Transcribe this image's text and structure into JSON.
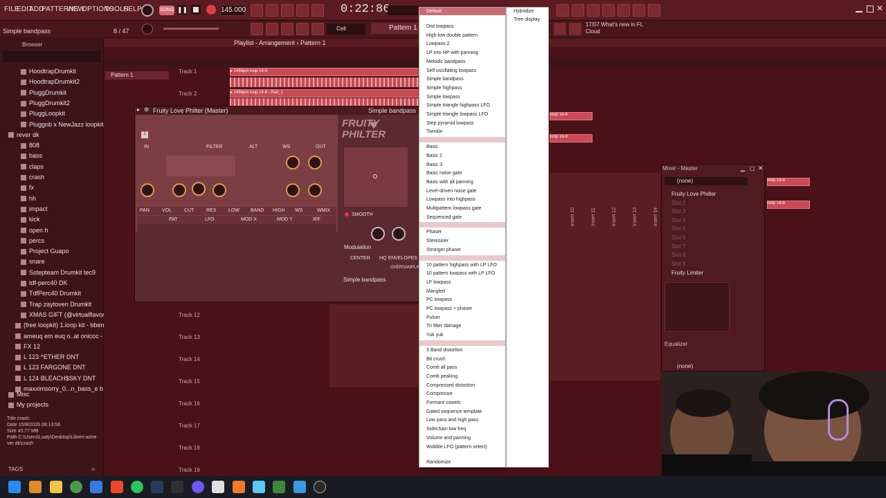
{
  "menu": {
    "items": [
      "FILE",
      "EDIT",
      "ADD",
      "PATTERNS",
      "VIEW",
      "OPTIONS",
      "TOOLS",
      "HELP"
    ],
    "song_label": "SONG",
    "bpm": "145.000",
    "time": "0:22:86"
  },
  "hint": {
    "text": "Simple bandpass",
    "count": "8 / 47"
  },
  "toolbar": {
    "snap_label": "Cell",
    "pattern": "Pattern 1",
    "news_date": "17/07",
    "news_title": "What's new in FL",
    "news_sub": "Cloud"
  },
  "browser": {
    "title": "Browser",
    "items": [
      {
        "label": "HoodtrapDrumkit",
        "type": "folder"
      },
      {
        "label": "HoodtrapDrumkit2",
        "type": "folder"
      },
      {
        "label": "PluggDrumkit",
        "type": "folder"
      },
      {
        "label": "PluggDrumkit2",
        "type": "folder"
      },
      {
        "label": "PluggLoopkit",
        "type": "folder"
      },
      {
        "label": "Pluggnb x NewJazz loopkit",
        "type": "folder"
      },
      {
        "label": "rever dk",
        "type": "folder"
      },
      {
        "label": "808",
        "type": "folder"
      },
      {
        "label": "bass",
        "type": "folder"
      },
      {
        "label": "claps",
        "type": "folder"
      },
      {
        "label": "crash",
        "type": "folder"
      },
      {
        "label": "fx",
        "type": "folder"
      },
      {
        "label": "hh",
        "type": "folder"
      },
      {
        "label": "impact",
        "type": "folder"
      },
      {
        "label": "kick",
        "type": "folder"
      },
      {
        "label": "open h",
        "type": "folder"
      },
      {
        "label": "percs",
        "type": "folder"
      },
      {
        "label": "Project Guapo",
        "type": "folder"
      },
      {
        "label": "snare",
        "type": "folder"
      },
      {
        "label": "Sstepteam Drumkit tec9",
        "type": "folder"
      },
      {
        "label": "tdf-perc40 DK",
        "type": "folder"
      },
      {
        "label": "TdfPerc40 Drumkit",
        "type": "folder"
      },
      {
        "label": "Trap zaytoven Drumkit",
        "type": "folder"
      },
      {
        "label": "XMAS GIFT (@virtualflavor)",
        "type": "folder"
      },
      {
        "label": "(free loopkit) 1.loop kit - bbeno",
        "type": "file"
      },
      {
        "label": "ameuq em euq o..at onicoc - tag",
        "type": "file"
      },
      {
        "label": "FX 12",
        "type": "file"
      },
      {
        "label": "L 123 ^ETHER DNT",
        "type": "file"
      },
      {
        "label": "L 123 FARGONE DNT",
        "type": "file"
      },
      {
        "label": "L 124 BLEACH$SKY DNT",
        "type": "file"
      },
      {
        "label": "maxximsorry_0...n_bass_e b c a",
        "type": "file"
      },
      {
        "label": "Misc",
        "type": "folder"
      },
      {
        "label": "My projects",
        "type": "folder"
      }
    ],
    "info_title_key": "Title",
    "info_title": "crash",
    "info_date_key": "Date",
    "info_date": "15/8/2026 06:13:56",
    "info_size_key": "Size",
    "info_size": "43.77 MB",
    "info_path_key": "Path",
    "info_path": "C:\\Users\\Luaty\\Desktop\\Libreri-as\\rever dk\\crash",
    "tags": "TAGS"
  },
  "playlist": {
    "title": "Playlist - Arrangement › Pattern 1",
    "pattern_item": "Pattern 1",
    "tracks": [
      "Track 1",
      "Track 2",
      "Track 12",
      "Track 13",
      "Track 14",
      "Track 15",
      "Track 16",
      "Track 17",
      "Track 18",
      "Track 19"
    ],
    "clip_text_1": "▸ 145bpm loop 16-8",
    "clip_text_2": "▸ 145bpm loop 16-8 - Part_1",
    "clip_text_right": "loop 16-8"
  },
  "plugin": {
    "title": "Fruity Love Philter (Master)",
    "preset": "Simple bandpass",
    "logo_line1": "FRUITY",
    "logo_line2": "PHILTER",
    "in_label": "IN",
    "filter_label": "FILTER",
    "alt_label": "ALT",
    "ws_label": "WS",
    "out_label": "OUT",
    "tabs": [
      "PAN",
      "VOL",
      "CUT",
      "RES",
      "LOW",
      "BAND",
      "HIGH",
      "WS",
      "WMIX"
    ],
    "sub_tabs": [
      "PAT",
      "LFO",
      "MOD X",
      "MOD Y",
      "IEF"
    ],
    "smooth_label": "SMOOTH",
    "modulation_label": "Modulation",
    "center_label": "CENTER",
    "hq_label": "HQ ENVELOPES",
    "oversampling_label": "OVERSAMPLING",
    "footer_preset": "Simple bandpass",
    "page_number": "1"
  },
  "dropdown": {
    "header": "Default",
    "groups": [
      [
        "Dist lowpass",
        "High-low double pattern",
        "Lowpass 2",
        "LP into HP with panning",
        "Melodic bandpass",
        "Self oscillating lowpass",
        "Simple bandpass",
        "Simple highpass",
        "Simple lowpass",
        "Simple triangle highpass LFO",
        "Simple triangle lowpass LFO",
        "Step pyramid lowpass",
        "Twinkle"
      ],
      [
        "Basic",
        "Basic 2",
        "Basic 3",
        "Basic noise gate",
        "Basic with alt panning",
        "Level-driven noise gate",
        "Lowpass into highpass",
        "Multipattern lowpass gate",
        "Sequenced gate"
      ],
      [
        "Phaser",
        "Stereoizer",
        "Stronger phaser"
      ],
      [
        "10 pattern highpass with LP LFO",
        "10 pattern lowpass with LP LFO",
        "LF lowpass",
        "Mangled",
        "PC lowpass",
        "PC lowpass + phaser",
        "Pulser",
        "Tri filter damage",
        "Yuk yuk"
      ],
      [
        "3 Band distortion",
        "Bit crush",
        "Comb all pass",
        "Comb peaking",
        "Compressed distortion",
        "Compressor",
        "Formant vowels",
        "Gated sequence template",
        "Low pass and high pass",
        "Sidechain low freq",
        "Volume and panning",
        "Wobble LFO (pattern select)"
      ]
    ],
    "footer": "Randomize",
    "right_items": [
      "Hybridize",
      "Tree display"
    ]
  },
  "mixer": {
    "title": "Mixer - Master",
    "preset": "(none)",
    "slots": [
      "Fruity Love Philter",
      "Slot 2",
      "Slot 3",
      "Slot 4",
      "Slot 5",
      "Slot 6",
      "Slot 7",
      "Slot 8",
      "Slot 9",
      "Fruity Limiter"
    ],
    "eq_label": "Equalizer",
    "preset2": "(none)",
    "insert_labels": [
      "Insert 10",
      "Insert 11",
      "Insert 12",
      "Insert 13",
      "Insert 14"
    ]
  }
}
